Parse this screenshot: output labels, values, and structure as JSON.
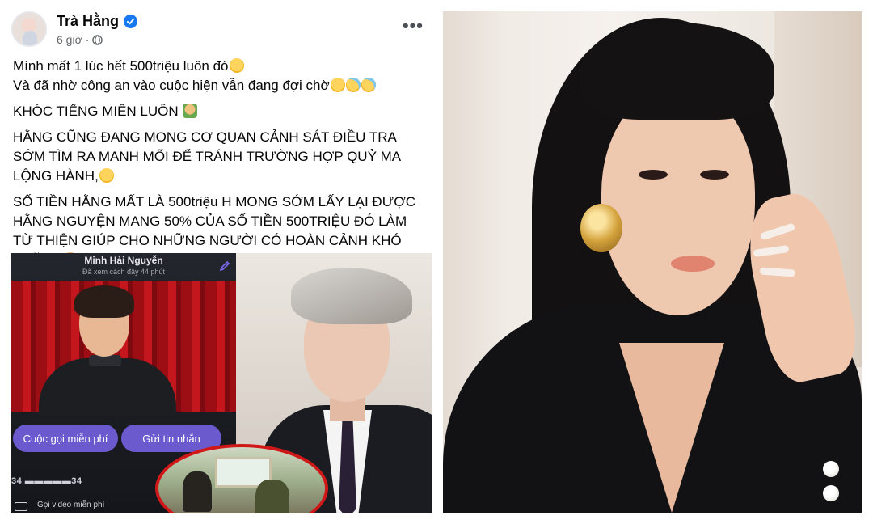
{
  "post": {
    "author": "Trà Hằng",
    "time": "6 giờ",
    "paragraphs": {
      "p1_line1": "Mình mất 1 lúc hết 500triệu luôn đó",
      "p1_line2": "Và đã nhờ công an vào cuộc hiện vẫn đang đợi chờ",
      "p2": "KHÓC TIẾNG MIÊN LUÔN",
      "p3": "HẰNG CŨNG ĐANG MONG CƠ QUAN CẢNH SÁT ĐIỀU TRA SỚM TÌM RA MANH MỐI ĐỂ TRÁNH TRƯỜNG HỢP QUỶ MA LỘNG HÀNH,",
      "p4": "SỐ TIỀN HẰNG MẤT LÀ 500triệu H MONG SỚM LẤY LẠI ĐƯỢC HẰNG NGUYỆN MANG 50% CỦA SỐ TIỀN 500TRIỆU ĐÓ LÀM TỪ THIỆN GIÚP CHO NHỮNG NGƯỜI CÓ HOÀN CẢNH KHÓ KHĂN Ạ"
    },
    "screenshot": {
      "contact_name": "Minh Hải Nguyễn",
      "last_seen": "Đã xem cách đây 44 phút",
      "call_button": "Cuộc gọi miễn phí",
      "message_button": "Gửi tin nhắn",
      "phone_number": "34 ▬▬▬▬▬34",
      "video_call": "Gọi video miễn phí"
    }
  },
  "colors": {
    "verified": "#1877f2",
    "button_purple": "#6a5acd",
    "highlight_red": "#d01818"
  },
  "icons": [
    "verified-badge-icon",
    "globe-icon",
    "more-options-icon",
    "pencil-icon",
    "video-camera-icon"
  ]
}
